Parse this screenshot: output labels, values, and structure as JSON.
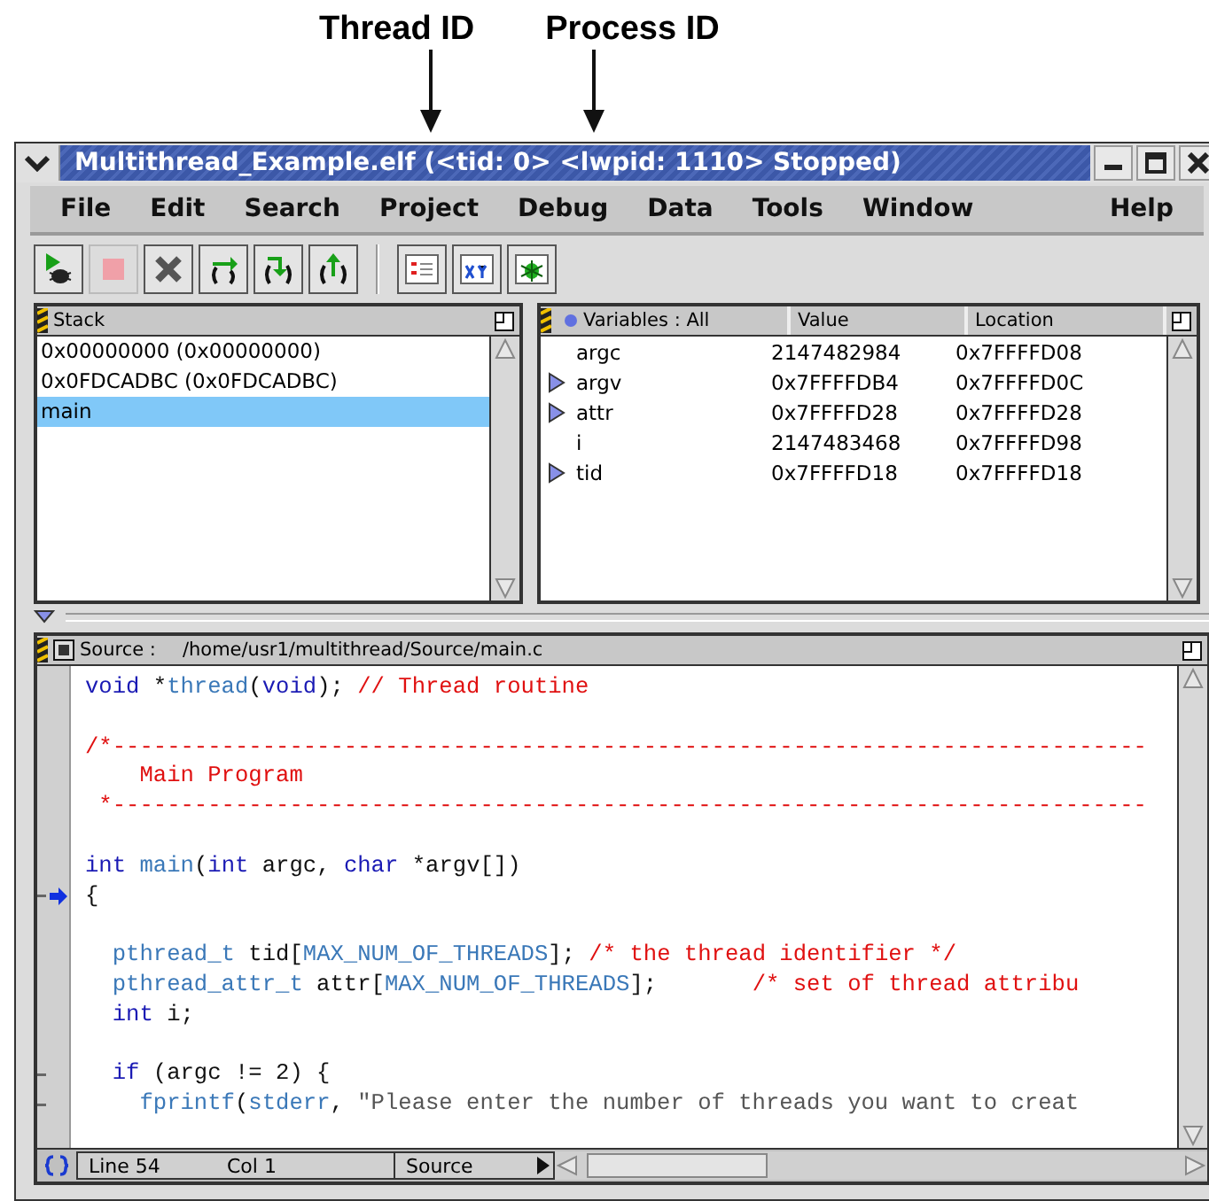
{
  "annotations": [
    {
      "label": "Thread ID"
    },
    {
      "label": "Process ID"
    }
  ],
  "window": {
    "title": "Multithread_Example.elf (<tid: 0>  <lwpid: 1110> Stopped)"
  },
  "menu": [
    "File",
    "Edit",
    "Search",
    "Project",
    "Debug",
    "Data",
    "Tools",
    "Window",
    "Help"
  ],
  "toolbar": {
    "groups": [
      [
        {
          "kind": "run-debug",
          "disabled": false
        },
        {
          "kind": "stop",
          "disabled": true
        },
        {
          "kind": "kill",
          "disabled": false
        },
        {
          "kind": "step-over",
          "disabled": false
        },
        {
          "kind": "step-into",
          "disabled": false
        },
        {
          "kind": "step-out",
          "disabled": false
        }
      ],
      [
        {
          "kind": "list",
          "disabled": false
        },
        {
          "kind": "xy",
          "disabled": false
        },
        {
          "kind": "bug",
          "disabled": false
        }
      ]
    ]
  },
  "stack": {
    "title": "Stack",
    "items": [
      {
        "text": "0x00000000 (0x00000000)",
        "selected": false
      },
      {
        "text": "0x0FDCADBC (0x0FDCADBC)",
        "selected": false
      },
      {
        "text": "main",
        "selected": true
      }
    ]
  },
  "variables": {
    "columns": [
      "Variables : All",
      "Value",
      "Location"
    ],
    "rows": [
      {
        "name": "argc",
        "value": "2147482984",
        "location": "0x7FFFFD08",
        "expandable": false
      },
      {
        "name": "argv",
        "value": "0x7FFFFDB4",
        "location": "0x7FFFFD0C",
        "expandable": true
      },
      {
        "name": "attr",
        "value": "0x7FFFFD28",
        "location": "0x7FFFFD28",
        "expandable": true
      },
      {
        "name": "i",
        "value": "2147483468",
        "location": "0x7FFFFD98",
        "expandable": false
      },
      {
        "name": "tid",
        "value": "0x7FFFFD18",
        "location": "0x7FFFFD18",
        "expandable": true
      }
    ]
  },
  "source": {
    "label": "Source :",
    "path": "/home/usr1/multithread/Source/main.c",
    "lines": [
      {
        "fold": false,
        "current": false,
        "tokens": [
          {
            "kind": "kw",
            "text": "void"
          },
          {
            "kind": "plain",
            "text": " *"
          },
          {
            "kind": "ident",
            "text": "thread"
          },
          {
            "kind": "plain",
            "text": "("
          },
          {
            "kind": "kw",
            "text": "void"
          },
          {
            "kind": "plain",
            "text": "); "
          },
          {
            "kind": "comment",
            "text": "// Thread routine"
          }
        ]
      },
      {
        "fold": false,
        "current": false
      },
      {
        "fold": false,
        "current": false,
        "tokens": [
          {
            "kind": "comment",
            "text": "/*----------------------------------------------------------------------------"
          }
        ]
      },
      {
        "fold": false,
        "current": false,
        "tokens": [
          {
            "kind": "comment",
            "text": "    Main Program"
          }
        ]
      },
      {
        "fold": false,
        "current": false,
        "tokens": [
          {
            "kind": "comment",
            "text": " *----------------------------------------------------------------------------"
          }
        ]
      },
      {
        "fold": false,
        "current": false
      },
      {
        "fold": false,
        "current": false,
        "tokens": [
          {
            "kind": "kw",
            "text": "int"
          },
          {
            "kind": "ident",
            "text": " main"
          },
          {
            "kind": "plain",
            "text": "("
          },
          {
            "kind": "kw",
            "text": "int"
          },
          {
            "kind": "plain",
            "text": " argc, "
          },
          {
            "kind": "kw",
            "text": "char"
          },
          {
            "kind": "plain",
            "text": " *argv[])"
          }
        ]
      },
      {
        "fold": true,
        "current": true,
        "tokens": [
          {
            "kind": "plain",
            "text": "{"
          }
        ]
      },
      {
        "fold": false,
        "current": false
      },
      {
        "fold": false,
        "current": false,
        "tokens": [
          {
            "kind": "ident",
            "text": "  pthread_t"
          },
          {
            "kind": "plain",
            "text": " tid["
          },
          {
            "kind": "ident",
            "text": "MAX_NUM_OF_THREADS"
          },
          {
            "kind": "plain",
            "text": "]; "
          },
          {
            "kind": "comment",
            "text": "/* the thread identifier */"
          }
        ]
      },
      {
        "fold": false,
        "current": false,
        "tokens": [
          {
            "kind": "ident",
            "text": "  pthread_attr_t"
          },
          {
            "kind": "plain",
            "text": " attr["
          },
          {
            "kind": "ident",
            "text": "MAX_NUM_OF_THREADS"
          },
          {
            "kind": "plain",
            "text": "];       "
          },
          {
            "kind": "comment",
            "text": "/* set of thread attribu"
          }
        ]
      },
      {
        "fold": false,
        "current": false,
        "tokens": [
          {
            "kind": "kw",
            "text": "  int"
          },
          {
            "kind": "plain",
            "text": " i;"
          }
        ]
      },
      {
        "fold": false,
        "current": false
      },
      {
        "fold": true,
        "current": false,
        "tokens": [
          {
            "kind": "kw",
            "text": "  if"
          },
          {
            "kind": "plain",
            "text": " (argc != 2) {"
          }
        ]
      },
      {
        "fold": true,
        "current": false,
        "tokens": [
          {
            "kind": "ident",
            "text": "    fprintf"
          },
          {
            "kind": "plain",
            "text": "("
          },
          {
            "kind": "ident",
            "text": "stderr"
          },
          {
            "kind": "plain",
            "text": ", "
          },
          {
            "kind": "string",
            "text": "\"Please enter the number of threads you want to creat"
          }
        ]
      }
    ]
  },
  "status": {
    "line": "Line 54",
    "col": "Col 1",
    "mode": "Source"
  }
}
